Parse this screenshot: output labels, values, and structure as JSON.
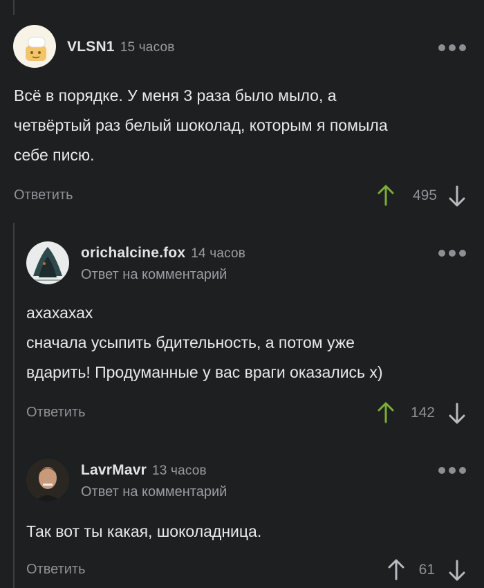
{
  "comments": [
    {
      "author": "VLSN1",
      "time": "15 часов",
      "reply_note": "",
      "lines": [
        "Всё в порядке. У меня 3 раза было мыло, а",
        "четвёртый раз белый шоколад, которым я помыла",
        "себе писю."
      ],
      "reply_label": "Ответить",
      "rating": "495",
      "upvote_color": "#7cae34"
    },
    {
      "author": "orichalcine.fox",
      "time": "14 часов",
      "reply_note": "Ответ на комментарий",
      "lines": [
        "ахахахах",
        "сначала усыпить бдительность, а потом уже",
        "вдарить! Продуманные у вас враги оказались х)"
      ],
      "reply_label": "Ответить",
      "rating": "142",
      "upvote_color": "#7cae34"
    },
    {
      "author": "LavrMavr",
      "time": "13 часов",
      "reply_note": "Ответ на комментарий",
      "lines": [
        "Так вот ты какая, шоколадница."
      ],
      "reply_label": "Ответить",
      "rating": "61",
      "upvote_color": "#b8bbbf"
    }
  ],
  "icons": {
    "upvote": "arrow-up-icon",
    "downvote": "arrow-down-icon",
    "more": "more-dots-icon"
  }
}
